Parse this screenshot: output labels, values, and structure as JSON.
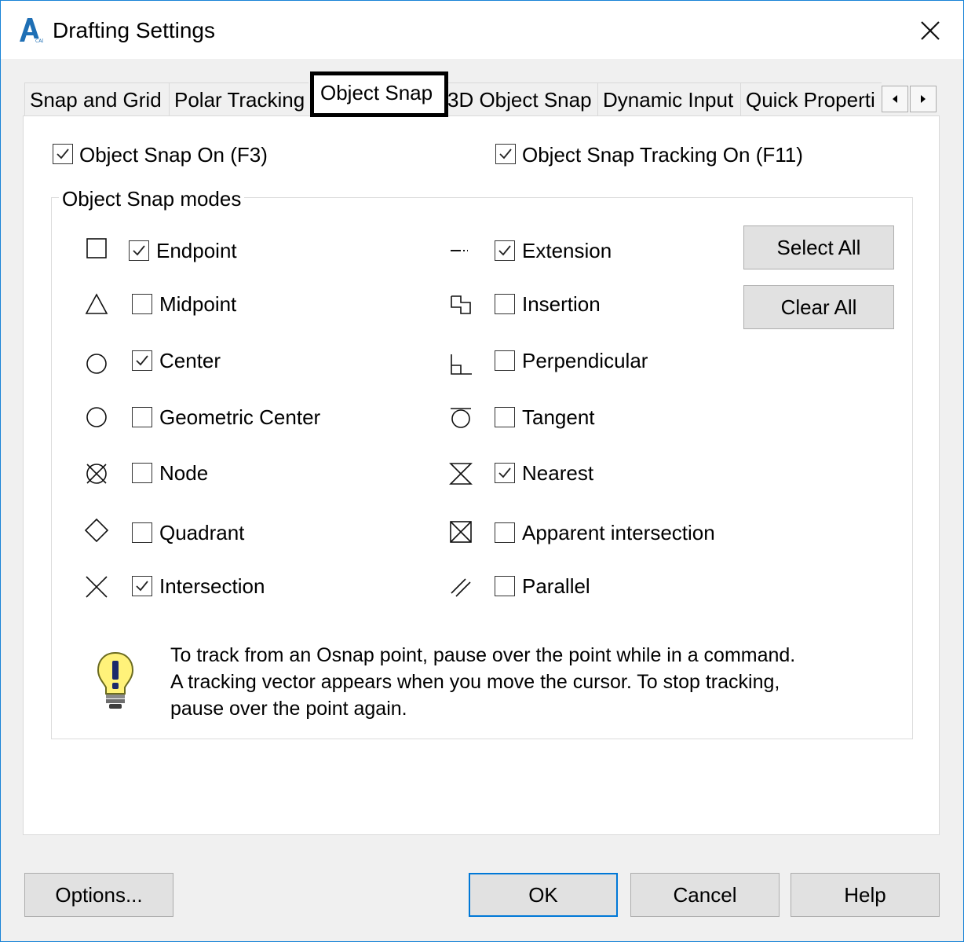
{
  "window": {
    "title": "Drafting Settings",
    "app_icon": "autocad-logo-icon",
    "close_icon": "close-icon"
  },
  "tabs": [
    {
      "label": "Snap and Grid"
    },
    {
      "label": "Polar Tracking"
    },
    {
      "label": "Object Snap",
      "active": true
    },
    {
      "label": "3D Object Snap"
    },
    {
      "label": "Dynamic Input"
    },
    {
      "label": "Quick Properti"
    }
  ],
  "tab_scroll": {
    "left_icon": "chevron-left-icon",
    "right_icon": "chevron-right-icon"
  },
  "object_snap_on": {
    "label": "Object Snap On (F3)",
    "checked": true
  },
  "object_snap_tracking_on": {
    "label": "Object Snap Tracking On (F11)",
    "checked": true
  },
  "modes_group": {
    "title": "Object Snap modes"
  },
  "modes_left": [
    {
      "label": "Endpoint",
      "checked": true,
      "icon": "endpoint-square-icon"
    },
    {
      "label": "Midpoint",
      "checked": false,
      "icon": "midpoint-triangle-icon"
    },
    {
      "label": "Center",
      "checked": true,
      "icon": "center-circle-icon"
    },
    {
      "label": "Geometric Center",
      "checked": false,
      "icon": "geometric-center-circle-icon"
    },
    {
      "label": "Node",
      "checked": false,
      "icon": "node-icon"
    },
    {
      "label": "Quadrant",
      "checked": false,
      "icon": "quadrant-diamond-icon"
    },
    {
      "label": "Intersection",
      "checked": true,
      "icon": "intersection-x-icon"
    }
  ],
  "modes_right": [
    {
      "label": "Extension",
      "checked": true,
      "icon": "extension-icon"
    },
    {
      "label": "Insertion",
      "checked": false,
      "icon": "insertion-icon"
    },
    {
      "label": "Perpendicular",
      "checked": false,
      "icon": "perpendicular-icon"
    },
    {
      "label": "Tangent",
      "checked": false,
      "icon": "tangent-icon"
    },
    {
      "label": "Nearest",
      "checked": true,
      "icon": "nearest-hourglass-icon"
    },
    {
      "label": "Apparent intersection",
      "checked": false,
      "icon": "apparent-intersection-icon"
    },
    {
      "label": "Parallel",
      "checked": false,
      "icon": "parallel-icon"
    }
  ],
  "buttons": {
    "select_all": "Select All",
    "clear_all": "Clear All",
    "options": "Options...",
    "ok": "OK",
    "cancel": "Cancel",
    "help": "Help"
  },
  "hint": {
    "icon": "lightbulb-icon",
    "text": "To track from an Osnap point, pause over the point while in a command.\n A tracking vector appears when you move the cursor.  To stop tracking,\npause over the point again."
  }
}
